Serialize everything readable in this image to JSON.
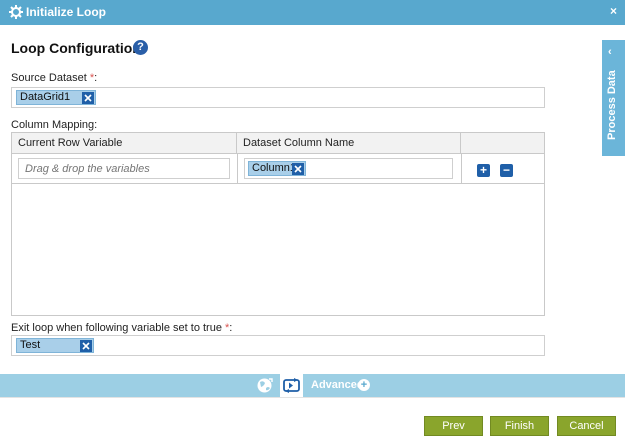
{
  "window": {
    "title": "Initialize Loop",
    "close_label": "×"
  },
  "page": {
    "title": "Loop Configuration",
    "help_label": "?"
  },
  "source_dataset": {
    "label": "Source Dataset",
    "required_mark": "*",
    "colon": ":",
    "tag": "DataGrid1"
  },
  "column_mapping": {
    "label": "Column Mapping:",
    "headers": [
      "Current Row Variable",
      "Dataset Column Name",
      ""
    ],
    "rows": [
      {
        "variable_placeholder": "Drag & drop the variables",
        "column_tag": "Column1"
      }
    ],
    "add_label": "+",
    "remove_label": "−"
  },
  "exit_loop": {
    "label": "Exit loop when following variable set to true ",
    "required_mark": "*",
    "colon": ":",
    "tag": "Test"
  },
  "footer": {
    "advanced_label": "Advanced",
    "advanced_plus": "+"
  },
  "buttons": {
    "prev": "Prev",
    "finish": "Finish",
    "cancel": "Cancel"
  },
  "side_panel": {
    "label": "Process Data",
    "chevron": "‹"
  }
}
